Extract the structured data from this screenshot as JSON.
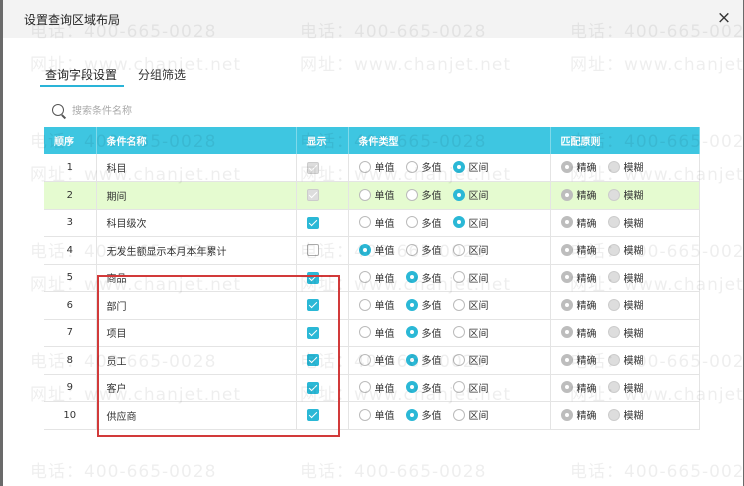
{
  "dialog": {
    "title": "设置查询区域布局",
    "close_label": "×"
  },
  "tabs": [
    {
      "label": "查询字段设置",
      "active": true
    },
    {
      "label": "分组筛选",
      "active": false
    }
  ],
  "search": {
    "placeholder": "搜索条件名称"
  },
  "table": {
    "headers": [
      "顺序",
      "条件名称",
      "显示",
      "条件类型",
      "匹配原则"
    ],
    "type_options": [
      "单值",
      "多值",
      "区间"
    ],
    "match_options": [
      "精确",
      "模糊"
    ],
    "rows": [
      {
        "seq": "1",
        "name": "科目",
        "show": "disabled-checked",
        "type": "区间",
        "match": "精确",
        "highlight": false
      },
      {
        "seq": "2",
        "name": "期间",
        "show": "disabled-checked",
        "type": "区间",
        "match": "精确",
        "highlight": true
      },
      {
        "seq": "3",
        "name": "科目级次",
        "show": "checked",
        "type": "区间",
        "match": "精确",
        "highlight": false
      },
      {
        "seq": "4",
        "name": "无发生额显示本月本年累计",
        "show": "unchecked",
        "type": "单值",
        "match": "精确",
        "highlight": false
      },
      {
        "seq": "5",
        "name": "商品",
        "show": "checked",
        "type": "多值",
        "match": "精确",
        "highlight": false
      },
      {
        "seq": "6",
        "name": "部门",
        "show": "checked",
        "type": "多值",
        "match": "精确",
        "highlight": false
      },
      {
        "seq": "7",
        "name": "项目",
        "show": "checked",
        "type": "多值",
        "match": "精确",
        "highlight": false
      },
      {
        "seq": "8",
        "name": "员工",
        "show": "checked",
        "type": "多值",
        "match": "精确",
        "highlight": false
      },
      {
        "seq": "9",
        "name": "客户",
        "show": "checked",
        "type": "多值",
        "match": "精确",
        "highlight": false
      },
      {
        "seq": "10",
        "name": "供应商",
        "show": "checked",
        "type": "多值",
        "match": "精确",
        "highlight": false
      }
    ]
  },
  "watermark": {
    "phone": "电话：400-665-0028",
    "site": "网址：www.chanjet.net"
  },
  "colors": {
    "accent": "#3ec6e1",
    "highlight_row": "#e5fbd0",
    "annotation_box": "#d23a3a"
  }
}
